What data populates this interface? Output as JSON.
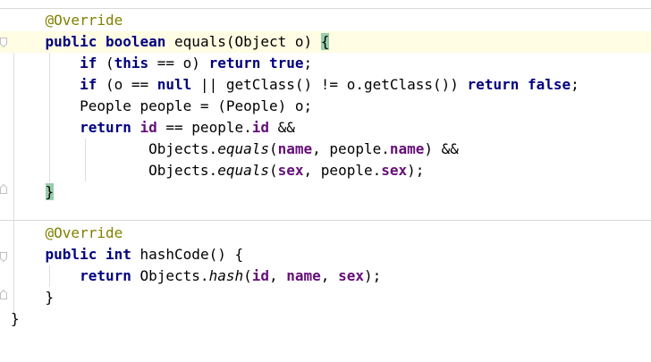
{
  "colors": {
    "keyword": "#000080",
    "annotation": "#808000",
    "field": "#660e7a",
    "caret_line": "#fffde3",
    "brace_match": "#99ccaa"
  },
  "code": {
    "ann1": "@Override",
    "l1": {
      "k1": "public",
      "k2": "boolean",
      "t1": " equals(Object o) ",
      "b": "{"
    },
    "l2": {
      "k1": "if",
      "t1": " (",
      "k2": "this",
      "t2": " == o) ",
      "k3": "return",
      "k4": "true",
      "t3": ";"
    },
    "l3": {
      "k1": "if",
      "t1": " (o == ",
      "k2": "null",
      "t2": " || getClass() != o.getClass()) ",
      "k3": "return",
      "k4": "false",
      "t3": ";"
    },
    "l4": {
      "t1": "People people = (People) o;"
    },
    "l5": {
      "k1": "return",
      "f1": "id",
      "t1": " == people.",
      "f2": "id",
      "t2": " &&"
    },
    "l6": {
      "t1": "Objects.",
      "s1": "equals",
      "t2": "(",
      "f1": "name",
      "t3": ", people.",
      "f2": "name",
      "t4": ") &&"
    },
    "l7": {
      "t1": "Objects.",
      "s1": "equals",
      "t2": "(",
      "f1": "sex",
      "t3": ", people.",
      "f2": "sex",
      "t4": ");"
    },
    "l8": {
      "b": "}"
    },
    "ann2": "@Override",
    "l9": {
      "k1": "public",
      "k2": "int",
      "t1": " hashCode() {"
    },
    "l10": {
      "k1": "return",
      "t1": " Objects.",
      "s1": "hash",
      "t2": "(",
      "f1": "id",
      "t3": ", ",
      "f2": "name",
      "t4": ", ",
      "f3": "sex",
      "t5": ");"
    },
    "l11": {
      "t1": "}"
    },
    "l12": {
      "t1": "}"
    }
  }
}
